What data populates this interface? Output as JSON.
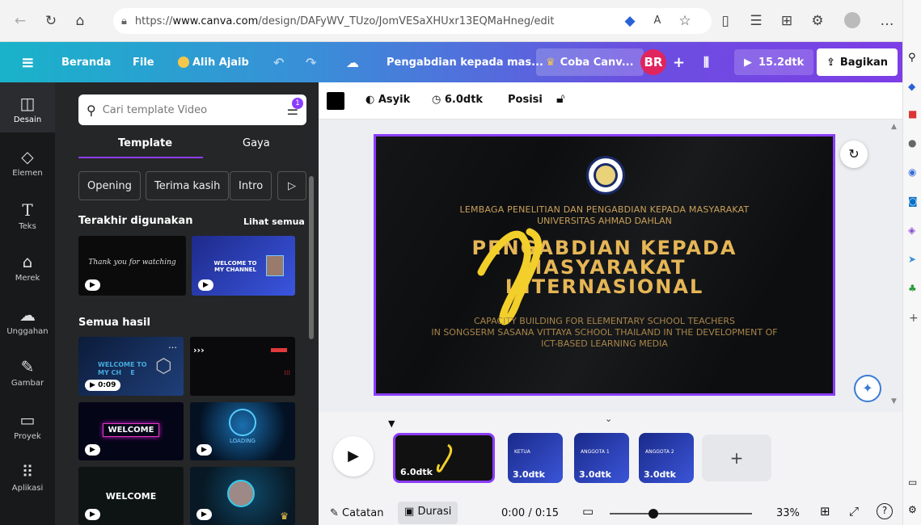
{
  "browser": {
    "url_prefix": "https://",
    "url_host": "www.canva.com",
    "url_path": "/design/DAFyWV_TUzo/JomVESaXHUxr13EQMaHneg/edit"
  },
  "topbar": {
    "home": "Beranda",
    "file": "File",
    "magic": "Alih Ajaib",
    "title": "Pengabdian kepada mas...",
    "trial": "Coba Canv...",
    "avatar": "BR",
    "duration": "15.2dtk",
    "share": "Bagikan"
  },
  "leftnav": [
    {
      "label": "Desain",
      "icon": "layout-icon"
    },
    {
      "label": "Elemen",
      "icon": "shapes-icon"
    },
    {
      "label": "Teks",
      "icon": "text-icon"
    },
    {
      "label": "Merek",
      "icon": "brand-icon"
    },
    {
      "label": "Unggahan",
      "icon": "upload-icon"
    },
    {
      "label": "Gambar",
      "icon": "draw-icon"
    },
    {
      "label": "Proyek",
      "icon": "folder-icon"
    },
    {
      "label": "Aplikasi",
      "icon": "apps-icon"
    }
  ],
  "panel": {
    "search_placeholder": "Cari template Video",
    "filter_badge": "1",
    "tab_template": "Template",
    "tab_style": "Gaya",
    "chips": [
      "Opening",
      "Terima kasih",
      "Intro"
    ],
    "recent_title": "Terakhir digunakan",
    "see_all": "Lihat semua",
    "all_results": "Semua hasil",
    "thumb_duration": "0:09",
    "thumb_text": {
      "thank_you": "Thank you for watching",
      "welcome_channel": "WELCOME TO MY CHANNEL",
      "welcome_to": "WELCOME TO",
      "my_channel": "MY CH    E",
      "welcome_neon": "WELCOME",
      "loading": "LOADING",
      "welcome_plain": "WELCOME"
    }
  },
  "toolbar2": {
    "animate": "Asyik",
    "timing": "6.0dtk",
    "position": "Posisi"
  },
  "slide": {
    "institution_line1": "LEMBAGA PENELITIAN DAN PENGABDIAN KEPADA MASYARAKAT",
    "institution_line2": "UNIVERSITAS AHMAD DAHLAN",
    "title_line1": "PENGABDIAN KEPADA",
    "title_line2": "MASYARAKAT",
    "title_line3": "INTERNASIONAL",
    "sub_line1": "CAPACITY BUILDING FOR ELEMENTARY SCHOOL TEACHERS",
    "sub_line2": "IN SONGSERM SASANA VITTAYA SCHOOL THAILAND IN THE DEVELOPMENT OF",
    "sub_line3": "ICT-BASED LEARNING MEDIA"
  },
  "timeline": {
    "clips": [
      {
        "duration": "6.0dtk"
      },
      {
        "duration": "3.0dtk",
        "label": "KETUA"
      },
      {
        "duration": "3.0dtk",
        "label": "ANGGOTA 1"
      },
      {
        "duration": "3.0dtk",
        "label": "ANGGOTA 2"
      }
    ],
    "notes": "Catatan",
    "duration": "Durasi",
    "time": "0:00 / 0:15",
    "zoom": "33%"
  },
  "colors": {
    "accent": "#8b3dff",
    "gold": "#c9a15a",
    "dark": "#18191b"
  }
}
